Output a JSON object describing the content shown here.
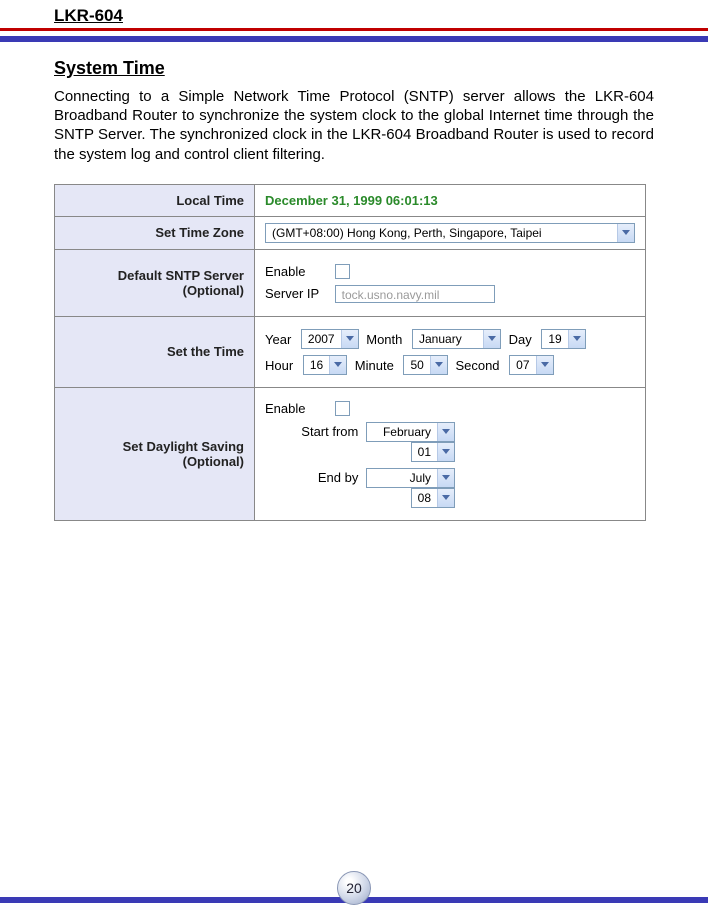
{
  "header": {
    "product": "LKR-604"
  },
  "section": {
    "heading": "System Time",
    "paragraph": "Connecting to a Simple Network Time Protocol (SNTP) server allows the LKR-604 Broadband Router to synchronize the system clock to the global Internet time through the SNTP Server. The synchronized clock in the LKR-604 Broadband Router is used to record the system log and control client filtering."
  },
  "panel": {
    "localTime": {
      "label": "Local Time",
      "value": "December 31, 1999 06:01:13"
    },
    "timezone": {
      "label": "Set Time Zone",
      "selected": "(GMT+08:00) Hong Kong, Perth, Singapore, Taipei"
    },
    "sntp": {
      "label": "Default SNTP Server (Optional)",
      "enable_label": "Enable",
      "serverip_label": "Server IP",
      "serverip_value": "tock.usno.navy.mil"
    },
    "setTime": {
      "label": "Set the Time",
      "year_label": "Year",
      "year": "2007",
      "month_label": "Month",
      "month": "January",
      "day_label": "Day",
      "day": "19",
      "hour_label": "Hour",
      "hour": "16",
      "minute_label": "Minute",
      "minute": "50",
      "second_label": "Second",
      "second": "07"
    },
    "daylight": {
      "label": "Set Daylight Saving (Optional)",
      "enable_label": "Enable",
      "start_label": "Start from",
      "start_month": "February",
      "start_day": "01",
      "end_label": "End by",
      "end_month": "July",
      "end_day": "08"
    }
  },
  "footer": {
    "page": "20"
  }
}
